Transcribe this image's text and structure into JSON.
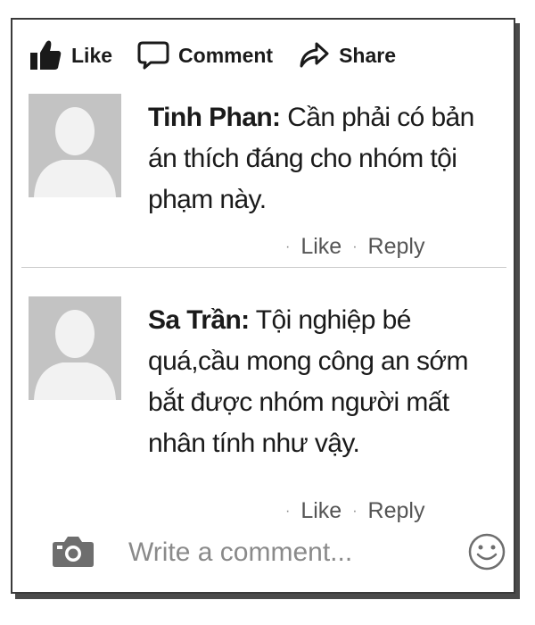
{
  "actions": {
    "like_label": "Like",
    "comment_label": "Comment",
    "share_label": "Share"
  },
  "comments": [
    {
      "author": "Tinh Phan:",
      "text": "Cần phải có bản án thích đáng cho nhóm tội phạm này.",
      "like_label": "Like",
      "reply_label": "Reply"
    },
    {
      "author": "Sa Trần:",
      "text": "Tội nghiệp bé quá,cầu mong công an sớm bắt được nhóm người mất nhân tính như vậy.",
      "like_label": "Like",
      "reply_label": "Reply"
    }
  ],
  "compose": {
    "placeholder": "Write a comment..."
  },
  "icons": {
    "like": "thumbs-up-icon",
    "comment": "speech-bubble-icon",
    "share": "share-arrow-icon",
    "camera": "camera-icon",
    "emoji": "smiley-icon",
    "avatar": "default-avatar-icon"
  }
}
